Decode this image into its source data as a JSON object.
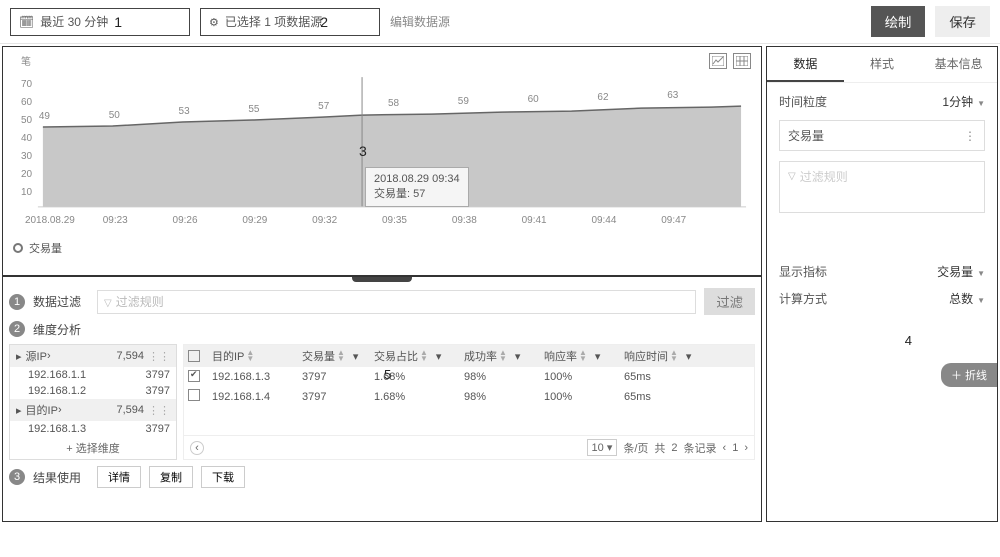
{
  "topbar": {
    "time_range_label": "最近 30 分钟",
    "step1_num": "1",
    "source_label": "已选择 1 项数据源",
    "step2_num": "2",
    "edit_source": "编辑数据源",
    "draw_btn": "绘制",
    "save_btn": "保存"
  },
  "chart_data": {
    "type": "area",
    "title": "",
    "ylabel": "笔",
    "ylim": [
      0,
      70
    ],
    "yticks": [
      10,
      20,
      30,
      40,
      50,
      60,
      70
    ],
    "x_start_label": "2018.08.29",
    "categories": [
      "09:23",
      "09:26",
      "09:29",
      "09:32",
      "09:35",
      "09:38",
      "09:41",
      "09:44",
      "09:47"
    ],
    "values_labeled": [
      49,
      50,
      53,
      55,
      57,
      58,
      59,
      60,
      62,
      63
    ],
    "series": [
      {
        "name": "交易量",
        "values": [
          49,
          50,
          53,
          55,
          57,
          58,
          59,
          60,
          62,
          63
        ]
      }
    ],
    "tooltip": {
      "time": "2018.08.29 09:34",
      "metric": "交易量",
      "value": 57
    }
  },
  "chart_legend": "交易量",
  "step3_num": "3",
  "bottom": {
    "step1": "1",
    "filter_label": "数据过滤",
    "filter_placeholder": "过滤规则",
    "filter_btn": "过滤",
    "step2": "2",
    "analysis_label": "维度分析",
    "dim1": {
      "name": "源IP",
      "total": "7,594",
      "rows": [
        {
          "ip": "192.168.1.1",
          "v": "3797"
        },
        {
          "ip": "192.168.1.2",
          "v": "3797"
        }
      ]
    },
    "dim2": {
      "name": "目的IP",
      "total": "7,594",
      "rows": [
        {
          "ip": "192.168.1.3",
          "v": "3797"
        }
      ]
    },
    "add_dim": "+ 选择维度",
    "table": {
      "cols": [
        "目的IP",
        "交易量",
        "交易占比",
        "成功率",
        "响应率",
        "响应时间"
      ],
      "rows": [
        {
          "checked": true,
          "ip": "192.168.1.3",
          "vol": "3797",
          "ratio": "1.68%",
          "succ": "98%",
          "resp": "100%",
          "rt": "65ms"
        },
        {
          "checked": false,
          "ip": "192.168.1.4",
          "vol": "3797",
          "ratio": "1.68%",
          "succ": "98%",
          "resp": "100%",
          "rt": "65ms"
        }
      ],
      "step5": "5",
      "page_size": "10",
      "page_unit": "条/页",
      "total_prefix": "共",
      "total": "2",
      "total_suffix": "条记录",
      "page_cur": "1"
    },
    "step3": "3",
    "result_label": "结果使用",
    "detail_btn": "详情",
    "copy_btn": "复制",
    "download_btn": "下载"
  },
  "right": {
    "tabs": [
      "数据",
      "样式",
      "基本信息"
    ],
    "granularity_label": "时间粒度",
    "granularity_value": "1分钟",
    "metric_name": "交易量",
    "filter_placeholder": "过滤规则",
    "show_metric_label": "显示指标",
    "show_metric_value": "交易量",
    "calc_label": "计算方式",
    "calc_value": "总数",
    "step4": "4",
    "add_line": "折线"
  }
}
